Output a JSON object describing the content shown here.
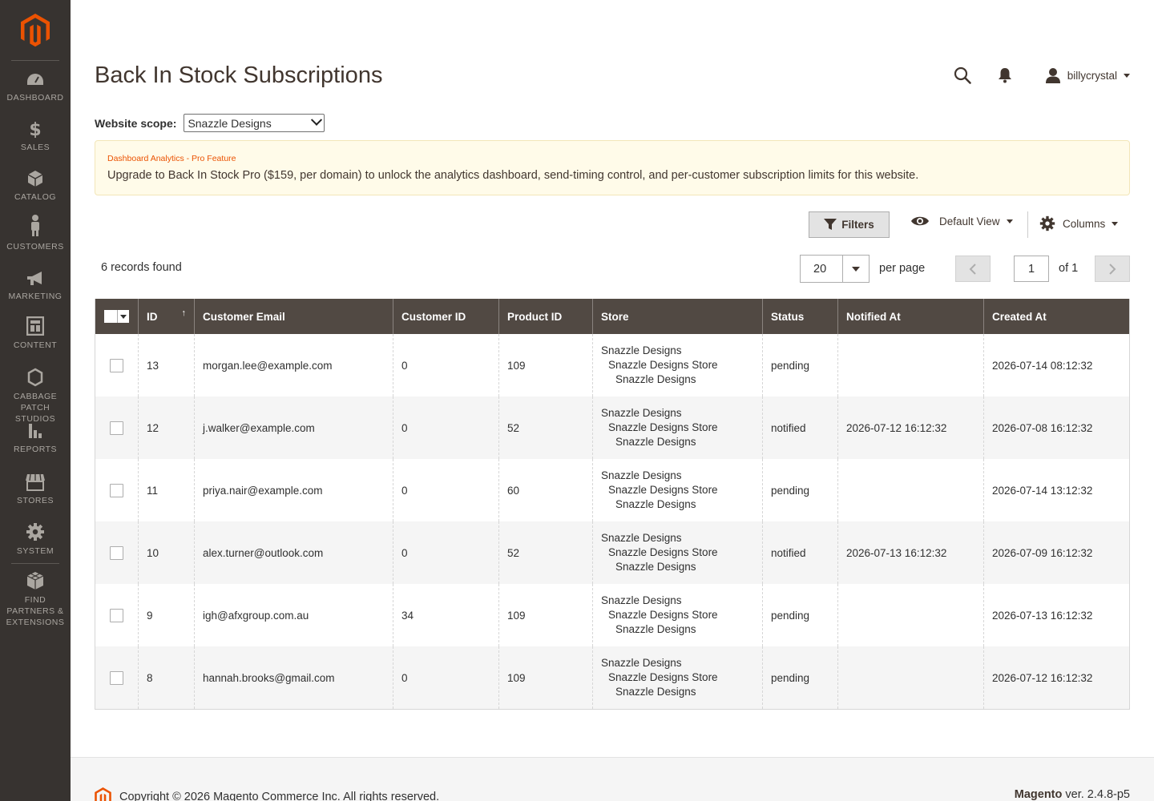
{
  "app": {
    "brand_color": "#eb5202",
    "sidebar_bg": "#373330",
    "grid_header_bg": "#514943"
  },
  "sidebar": {
    "items": [
      {
        "label": "DASHBOARD",
        "icon": "dashboard-icon"
      },
      {
        "label": "SALES",
        "icon": "dollar-icon"
      },
      {
        "label": "CATALOG",
        "icon": "cube-icon"
      },
      {
        "label": "CUSTOMERS",
        "icon": "person-icon"
      },
      {
        "label": "MARKETING",
        "icon": "megaphone-icon"
      },
      {
        "label": "CONTENT",
        "icon": "layout-icon"
      },
      {
        "label": "CABBAGE\nPATCH STUDIOS",
        "icon": "hexagon-icon"
      },
      {
        "label": "REPORTS",
        "icon": "bar-chart-icon"
      },
      {
        "label": "STORES",
        "icon": "storefront-icon"
      },
      {
        "label": "SYSTEM",
        "icon": "gear-icon"
      },
      {
        "label": "FIND\nPARTNERS &\nEXTENSIONS",
        "icon": "blocks-icon"
      }
    ]
  },
  "header": {
    "title": "Back In Stock Subscriptions",
    "username": "billycrystal"
  },
  "scope": {
    "label": "Website scope:",
    "selected": "Snazzle Designs"
  },
  "notice": {
    "title": "Dashboard Analytics - Pro Feature",
    "text": "Upgrade to Back In Stock Pro ($159, per domain) to unlock the analytics dashboard, send-timing control, and per-customer subscription limits for this website."
  },
  "toolbar": {
    "filters_label": "Filters",
    "view_label": "Default View",
    "columns_label": "Columns"
  },
  "pager": {
    "records_found": "6 records found",
    "per_page_value": "20",
    "per_page_label": "per page",
    "current_page": "1",
    "of_pages": "of 1"
  },
  "grid": {
    "columns": [
      "ID",
      "Customer Email",
      "Customer ID",
      "Product ID",
      "Store",
      "Status",
      "Notified At",
      "Created At"
    ],
    "sort_indicator": "↑",
    "rows": [
      {
        "id": "13",
        "email": "morgan.lee@example.com",
        "customer_id": "0",
        "product_id": "109",
        "store": [
          "Snazzle Designs",
          "Snazzle Designs Store",
          "Snazzle Designs"
        ],
        "status": "pending",
        "notified_at": "",
        "created_at": "2026-07-14 08:12:32"
      },
      {
        "id": "12",
        "email": "j.walker@example.com",
        "customer_id": "0",
        "product_id": "52",
        "store": [
          "Snazzle Designs",
          "Snazzle Designs Store",
          "Snazzle Designs"
        ],
        "status": "notified",
        "notified_at": "2026-07-12 16:12:32",
        "created_at": "2026-07-08 16:12:32"
      },
      {
        "id": "11",
        "email": "priya.nair@example.com",
        "customer_id": "0",
        "product_id": "60",
        "store": [
          "Snazzle Designs",
          "Snazzle Designs Store",
          "Snazzle Designs"
        ],
        "status": "pending",
        "notified_at": "",
        "created_at": "2026-07-14 13:12:32"
      },
      {
        "id": "10",
        "email": "alex.turner@outlook.com",
        "customer_id": "0",
        "product_id": "52",
        "store": [
          "Snazzle Designs",
          "Snazzle Designs Store",
          "Snazzle Designs"
        ],
        "status": "notified",
        "notified_at": "2026-07-13 16:12:32",
        "created_at": "2026-07-09 16:12:32"
      },
      {
        "id": "9",
        "email": "igh@afxgroup.com.au",
        "customer_id": "34",
        "product_id": "109",
        "store": [
          "Snazzle Designs",
          "Snazzle Designs Store",
          "Snazzle Designs"
        ],
        "status": "pending",
        "notified_at": "",
        "created_at": "2026-07-13 16:12:32"
      },
      {
        "id": "8",
        "email": "hannah.brooks@gmail.com",
        "customer_id": "0",
        "product_id": "109",
        "store": [
          "Snazzle Designs",
          "Snazzle Designs Store",
          "Snazzle Designs"
        ],
        "status": "pending",
        "notified_at": "",
        "created_at": "2026-07-12 16:12:32"
      }
    ]
  },
  "footer": {
    "copyright": "Copyright © 2026 Magento Commerce Inc. All rights reserved.",
    "brand": "Magento",
    "version": " ver. 2.4.8-p5"
  }
}
